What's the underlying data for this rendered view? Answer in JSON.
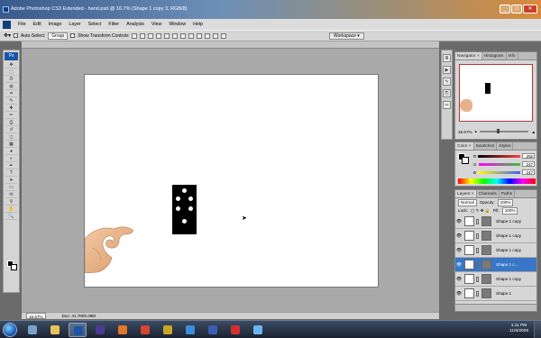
{
  "window": {
    "title": "Adobe Photoshop CS3 Extended - hand.psd @ 16.7% (Shape 1 copy 3, RGB/8)",
    "minimize": "_",
    "maximize": "□",
    "close": "✕"
  },
  "menu": [
    "File",
    "Edit",
    "Image",
    "Layer",
    "Select",
    "Filter",
    "Analysis",
    "View",
    "Window",
    "Help"
  ],
  "options": {
    "auto_select_label": "Auto-Select:",
    "auto_select_value": "Group",
    "show_transform_label": "Show Transform Controls",
    "workspace_label": "Workspace ▾"
  },
  "toolbox": {
    "badge": "Ps",
    "tools": [
      "move-icon",
      "marquee-icon",
      "lasso-icon",
      "quick-select-icon",
      "crop-icon",
      "slice-icon",
      "healing-icon",
      "brush-icon",
      "clone-stamp-icon",
      "history-brush-icon",
      "eraser-icon",
      "gradient-icon",
      "blur-icon",
      "dodge-icon",
      "pen-icon",
      "type-icon",
      "path-select-icon",
      "rectangle-icon",
      "notes-icon",
      "eyedropper-icon",
      "hand-icon",
      "zoom-icon"
    ],
    "tool_glyphs": [
      "✥",
      "⬚",
      "ʘ",
      "◍",
      "⌗",
      "✎",
      "✚",
      "✏",
      "⎙",
      "↺",
      "◻",
      "▦",
      "●",
      "◐",
      "✒",
      "T",
      "➤",
      "▭",
      "✉",
      "⚲",
      "✋",
      "🔍"
    ]
  },
  "document": {
    "zoom_status": "16.67%",
    "doc_status": "Doc: 41.7M/6.09M"
  },
  "dock": {
    "icons": [
      "history-icon",
      "actions-icon",
      "brushes-icon",
      "clone-source-icon",
      "tool-presets-icon"
    ],
    "glyphs": [
      "≣",
      "▶",
      "✎",
      "⎘",
      "✂"
    ]
  },
  "navigator": {
    "tabs": [
      "Navigator ×",
      "Histogram",
      "Info"
    ],
    "zoom": "16.67%"
  },
  "color_panel": {
    "tabs": [
      "Color ×",
      "Swatches",
      "Styles"
    ],
    "channels": [
      {
        "label": "R",
        "value": "255",
        "color": "#ff4040"
      },
      {
        "label": "G",
        "value": "247",
        "color": "#40c040"
      },
      {
        "label": "B",
        "value": "247",
        "color": "#4060ff"
      }
    ]
  },
  "layers_panel": {
    "tabs": [
      "Layers ×",
      "Channels",
      "Paths"
    ],
    "blend_mode": "Normal",
    "opacity_label": "Opacity:",
    "opacity_value": "100%",
    "lock_label": "Lock:",
    "fill_label": "Fill:",
    "fill_value": "100%",
    "layers": [
      {
        "name": "Shape 1 copy",
        "selected": false
      },
      {
        "name": "Shape 1 copy",
        "selected": false
      },
      {
        "name": "Shape 1 copy",
        "selected": false
      },
      {
        "name": "Shape 1 c...",
        "selected": true
      },
      {
        "name": "Shape 1 copy",
        "selected": false
      },
      {
        "name": "Shape 1",
        "selected": false
      }
    ]
  },
  "taskbar": {
    "items": [
      {
        "name": "show-desktop-icon",
        "color": "#7aa0c8",
        "active": false
      },
      {
        "name": "folder-icon",
        "color": "#e7c25a",
        "active": false
      },
      {
        "name": "photoshop-icon",
        "color": "#1a55a8",
        "active": true
      },
      {
        "name": "after-effects-icon",
        "color": "#4b3a8f",
        "active": false
      },
      {
        "name": "firefox-icon",
        "color": "#e0782a",
        "active": false
      },
      {
        "name": "chrome-icon",
        "color": "#d6452f",
        "active": false
      },
      {
        "name": "winamp-icon",
        "color": "#c9a524",
        "active": false
      },
      {
        "name": "media-icon",
        "color": "#3a8fd9",
        "active": false
      },
      {
        "name": "game-icon",
        "color": "#3c5fb5",
        "active": false
      },
      {
        "name": "app-icon",
        "color": "#d22f2f",
        "active": false
      },
      {
        "name": "itunes-icon",
        "color": "#6bb4f0",
        "active": false
      }
    ],
    "clock_time": "1:11 PM",
    "clock_date": "11/6/2009"
  }
}
